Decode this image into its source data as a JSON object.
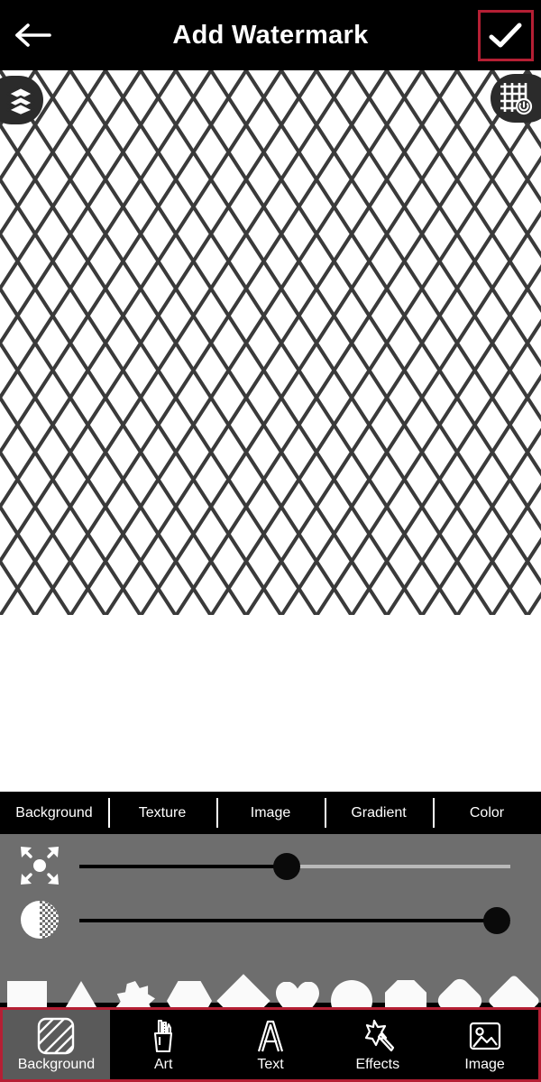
{
  "header": {
    "back_icon": "arrow-left-icon",
    "title": "Add Watermark",
    "confirm_icon": "check-icon",
    "highlight_color": "#b51f34"
  },
  "canvas": {
    "layers_icon": "layers-icon",
    "grid_icon": "grid-timer-icon",
    "background_color": "#ffffff",
    "pattern_line_color": "#3a3a3a",
    "pattern_name": "diamond-lattice"
  },
  "tabs": [
    {
      "label": "Background",
      "selected": true
    },
    {
      "label": "Texture",
      "selected": false
    },
    {
      "label": "Image",
      "selected": false
    },
    {
      "label": "Gradient",
      "selected": false
    },
    {
      "label": "Color",
      "selected": false
    }
  ],
  "sliders": [
    {
      "name": "size",
      "icon": "expand-arrows-icon",
      "value": 48,
      "min": 0,
      "max": 100
    },
    {
      "name": "opacity",
      "icon": "opacity-icon",
      "value": 100,
      "min": 0,
      "max": 100
    }
  ],
  "shapes": [
    {
      "name": "square"
    },
    {
      "name": "triangle"
    },
    {
      "name": "star-8-point"
    },
    {
      "name": "hexagon"
    },
    {
      "name": "diamond"
    },
    {
      "name": "heart"
    },
    {
      "name": "circle"
    },
    {
      "name": "octagon"
    },
    {
      "name": "rounded-diamond"
    },
    {
      "name": "diamond-alt"
    }
  ],
  "bottom_nav": [
    {
      "label": "Background",
      "icon": "stripes-icon",
      "active": true
    },
    {
      "label": "Art",
      "icon": "pencil-cup-icon",
      "active": false
    },
    {
      "label": "Text",
      "icon": "letter-a-icon",
      "active": false
    },
    {
      "label": "Effects",
      "icon": "magic-wand-icon",
      "active": false
    },
    {
      "label": "Image",
      "icon": "photo-icon",
      "active": false
    }
  ],
  "colors": {
    "panel_bg": "#6e6e6e",
    "nav_bg": "#000000",
    "active_nav_bg": "#5a5a5a",
    "accent_red": "#b51f34"
  }
}
